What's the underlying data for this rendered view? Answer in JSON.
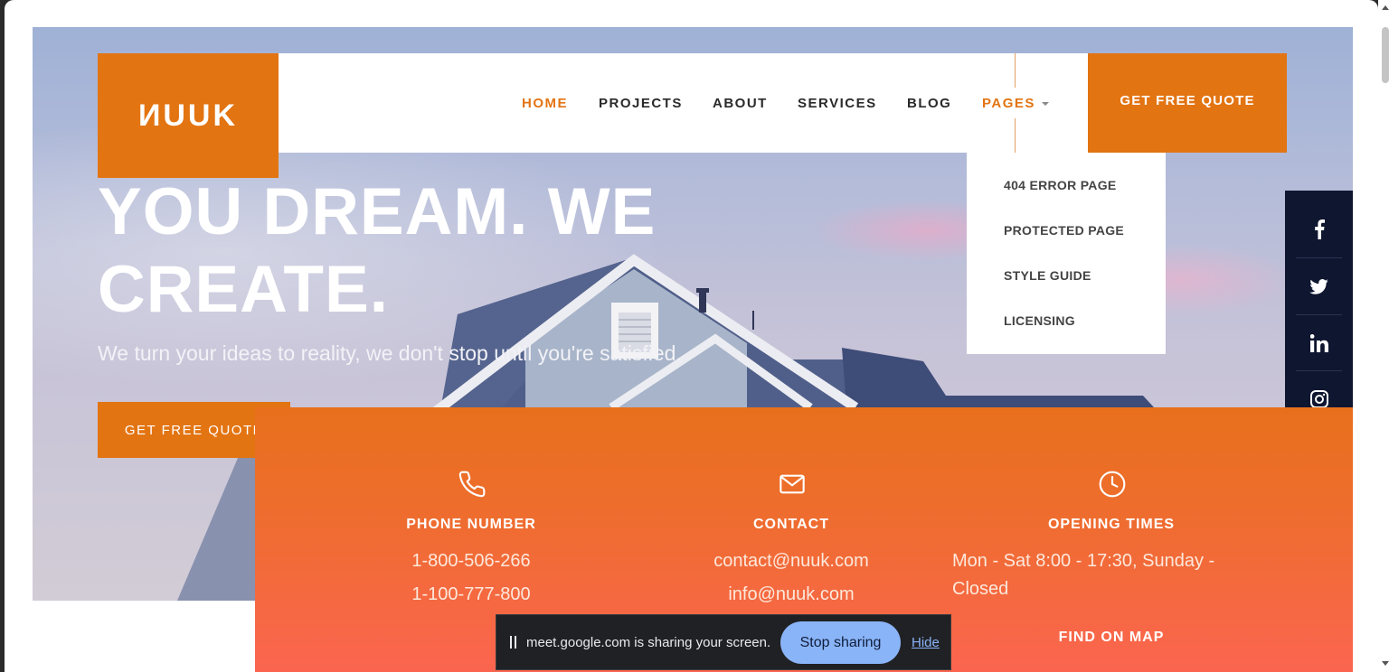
{
  "brand": {
    "logo": "ИUUK",
    "accent": "#e37412",
    "panel_bottom": "#fb6550",
    "social_bg": "#0e1630"
  },
  "nav": {
    "items": [
      {
        "label": "HOME",
        "active": true
      },
      {
        "label": "PROJECTS",
        "active": false
      },
      {
        "label": "ABOUT",
        "active": false
      },
      {
        "label": "SERVICES",
        "active": false
      },
      {
        "label": "BLOG",
        "active": false
      },
      {
        "label": "PAGES",
        "active": true
      }
    ],
    "cta": "GET FREE QUOTE"
  },
  "dropdown": {
    "items": [
      "404 ERROR PAGE",
      "PROTECTED PAGE",
      "STYLE GUIDE",
      "LICENSING"
    ]
  },
  "social": [
    "facebook-icon",
    "twitter-icon",
    "linkedin-icon",
    "instagram-icon"
  ],
  "hero": {
    "title_line1": "YOU DREAM. WE",
    "title_line2": "CREATE.",
    "subtitle": "We turn your ideas to reality, we don't stop until you're satisfied.",
    "cta": "GET FREE QUOTE"
  },
  "info": {
    "phone": {
      "icon": "phone-icon",
      "label": "PHONE NUMBER",
      "values": [
        "1-800-506-266",
        "1-100-777-800"
      ]
    },
    "contact": {
      "icon": "mail-icon",
      "label": "CONTACT",
      "values": [
        "contact@nuuk.com",
        "info@nuuk.com"
      ]
    },
    "hours": {
      "icon": "clock-icon",
      "label": "OPENING TIMES",
      "line1": "Mon - Sat 8:00 - 17:30, Sunday -",
      "line2": "Closed",
      "map_link": "FIND ON MAP"
    }
  },
  "share_bar": {
    "message": "meet.google.com is sharing your screen.",
    "stop": "Stop sharing",
    "hide": "Hide"
  }
}
